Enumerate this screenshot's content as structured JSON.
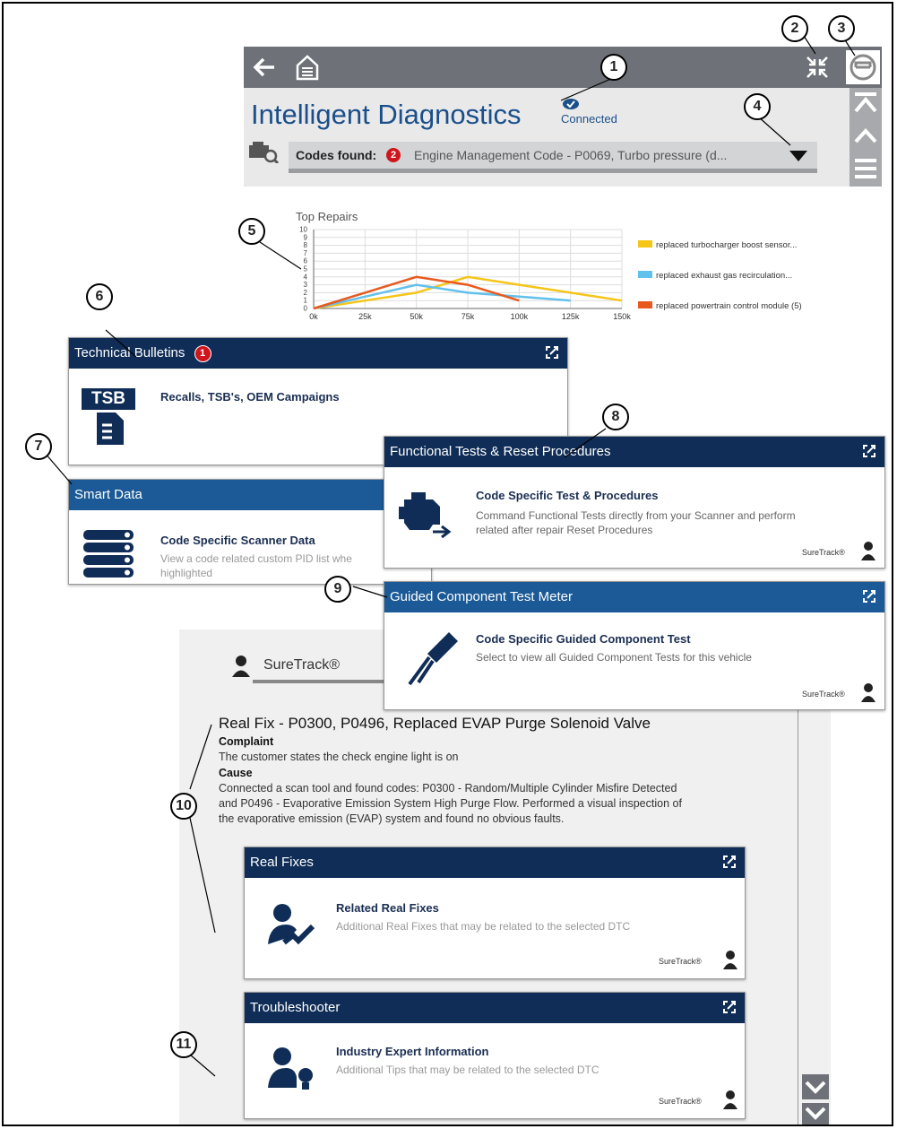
{
  "header": {
    "title": "Intelligent Diagnostics",
    "status": "Connected",
    "codes_label": "Codes found:",
    "codes_count": "2",
    "codes_text": "Engine Management Code - P0069, Turbo pressure (d..."
  },
  "chart_data": {
    "type": "line",
    "title": "Top Repairs",
    "categories": [
      "0k",
      "25k",
      "50k",
      "75k",
      "100k",
      "125k",
      "150k"
    ],
    "yticks": [
      "0",
      "1",
      "2",
      "3",
      "4",
      "5",
      "6",
      "7",
      "8",
      "9",
      "10"
    ],
    "ylim": [
      0,
      10
    ],
    "grid": true,
    "legend": "right",
    "series": [
      {
        "name": "replaced turbocharger boost sensor...",
        "color": "#f5c518",
        "values": [
          0,
          1,
          2,
          4,
          3,
          2,
          1
        ]
      },
      {
        "name": "replaced exhaust gas recirculation...",
        "color": "#62c0ec",
        "values": [
          0,
          1.5,
          3,
          2,
          1.5,
          1,
          null
        ]
      },
      {
        "name": "replaced powertrain control module (5)",
        "color": "#e8591e",
        "values": [
          0,
          2,
          4,
          3,
          1,
          null,
          null
        ]
      }
    ]
  },
  "tsb": {
    "header": "Technical Bulletins",
    "badge": "1",
    "icon_text": "TSB",
    "title": "Recalls, TSB's, OEM Campaigns"
  },
  "smart": {
    "header": "Smart Data",
    "title": "Code Specific Scanner Data",
    "desc1": "View a code related custom PID list whe",
    "desc2": "highlighted"
  },
  "functional": {
    "header": "Functional Tests & Reset Procedures",
    "title": "Code Specific Test & Procedures",
    "desc1": "Command Functional Tests directly from your Scanner and perform",
    "desc2": "related after repair Reset Procedures",
    "brand": "SureTrack®"
  },
  "guided": {
    "header": "Guided Component Test Meter",
    "title": "Code Specific Guided Component Test",
    "desc": "Select to view all Guided Component Tests for this vehicle",
    "brand": "SureTrack®"
  },
  "suretrack_panel": {
    "tab": "SureTrack®",
    "fix_title": "Real Fix - P0300, P0496, Replaced EVAP Purge Solenoid Valve",
    "complaint_label": "Complaint",
    "complaint": "The customer states the check engine light is on",
    "cause_label": "Cause",
    "cause1": "Connected a scan tool and found codes: P0300 - Random/Multiple Cylinder Misfire Detected",
    "cause2": "and P0496 - Evaporative Emission System High Purge Flow. Performed a visual inspection of",
    "cause3": "the evaporative emission (EVAP) system and found no obvious faults."
  },
  "realfixes": {
    "header": "Real Fixes",
    "title": "Related Real Fixes",
    "desc": "Additional Real Fixes that may be related to the selected DTC",
    "brand": "SureTrack®"
  },
  "trouble": {
    "header": "Troubleshooter",
    "title": "Industry Expert Information",
    "desc": "Additional Tips that may be related to the selected DTC",
    "brand": "SureTrack®"
  },
  "callouts": [
    "1",
    "2",
    "3",
    "4",
    "5",
    "6",
    "7",
    "8",
    "9",
    "10",
    "11"
  ]
}
